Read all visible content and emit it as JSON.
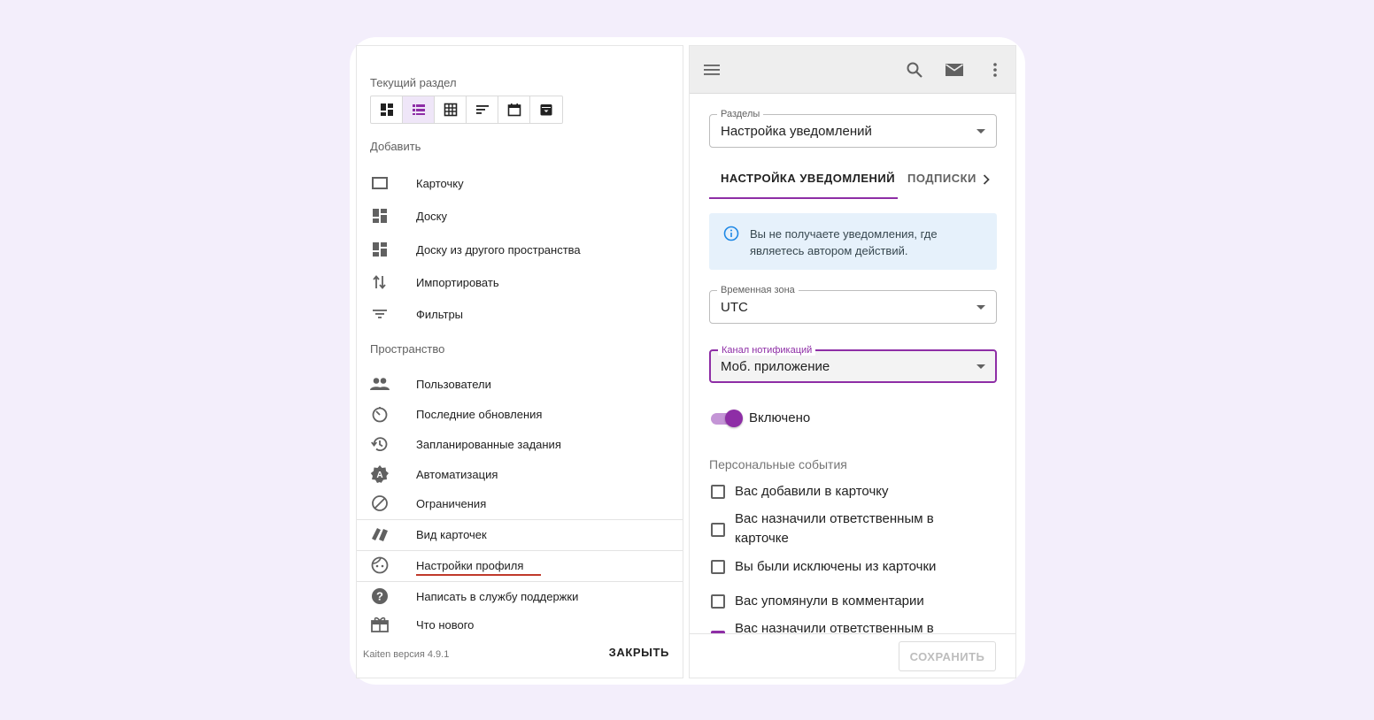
{
  "left": {
    "current_section_label": "Текущий раздел",
    "view_buttons": [
      "dashboard-view",
      "list-view",
      "table-view",
      "sort-view",
      "calendar-view",
      "archive-view"
    ],
    "add_label": "Добавить",
    "add_items": [
      {
        "label": "Карточку",
        "icon": "card-icon"
      },
      {
        "label": "Доску",
        "icon": "board-icon"
      },
      {
        "label": "Доску из другого пространства",
        "icon": "board-copy-icon"
      },
      {
        "label": "Импортировать",
        "icon": "import-icon"
      },
      {
        "label": "Фильтры",
        "icon": "filter-icon"
      }
    ],
    "space_label": "Пространство",
    "space_items": [
      {
        "label": "Пользователи",
        "icon": "users-icon"
      },
      {
        "label": "Последние обновления",
        "icon": "timer-icon"
      },
      {
        "label": "Запланированные задания",
        "icon": "history-icon"
      },
      {
        "label": "Автоматизация",
        "icon": "automation-icon"
      },
      {
        "label": "Ограничения",
        "icon": "block-icon"
      }
    ],
    "other_items": [
      {
        "label": "Вид карточек",
        "icon": "cards-view-icon"
      },
      {
        "label": "Настройки профиля",
        "icon": "profile-face-icon"
      },
      {
        "label": "Написать в службу поддержки",
        "icon": "help-icon"
      },
      {
        "label": "Что нового",
        "icon": "gift-icon"
      }
    ],
    "version": "Kaiten версия 4.9.1",
    "close_label": "ЗАКРЫТЬ"
  },
  "right": {
    "sections_field": {
      "label": "Разделы",
      "value": "Настройка уведомлений"
    },
    "tabs": [
      "НАСТРОЙКА УВЕДОМЛЕНИЙ",
      "ПОДПИСКИ"
    ],
    "info_text": "Вы не получаете уведомления, где являетесь автором действий.",
    "timezone_field": {
      "label": "Временная зона",
      "value": "UTC"
    },
    "channel_field": {
      "label": "Канал нотификаций",
      "value": "Моб. приложение"
    },
    "toggle_label": "Включено",
    "toggle_on": true,
    "personal_events_label": "Персональные события",
    "checkboxes": [
      "Вас добавили в карточку",
      "Вас назначили ответственным в карточке",
      "Вы были исключены из карточки",
      "Вас упомянули в комментарии",
      "Вас назначили ответственным в"
    ],
    "save_label": "СОХРАНИТЬ"
  },
  "colors": {
    "accent": "#8e2ea6",
    "background": "#f3eefb",
    "info_bg": "#e6f1fb",
    "underline": "#c0392b"
  }
}
